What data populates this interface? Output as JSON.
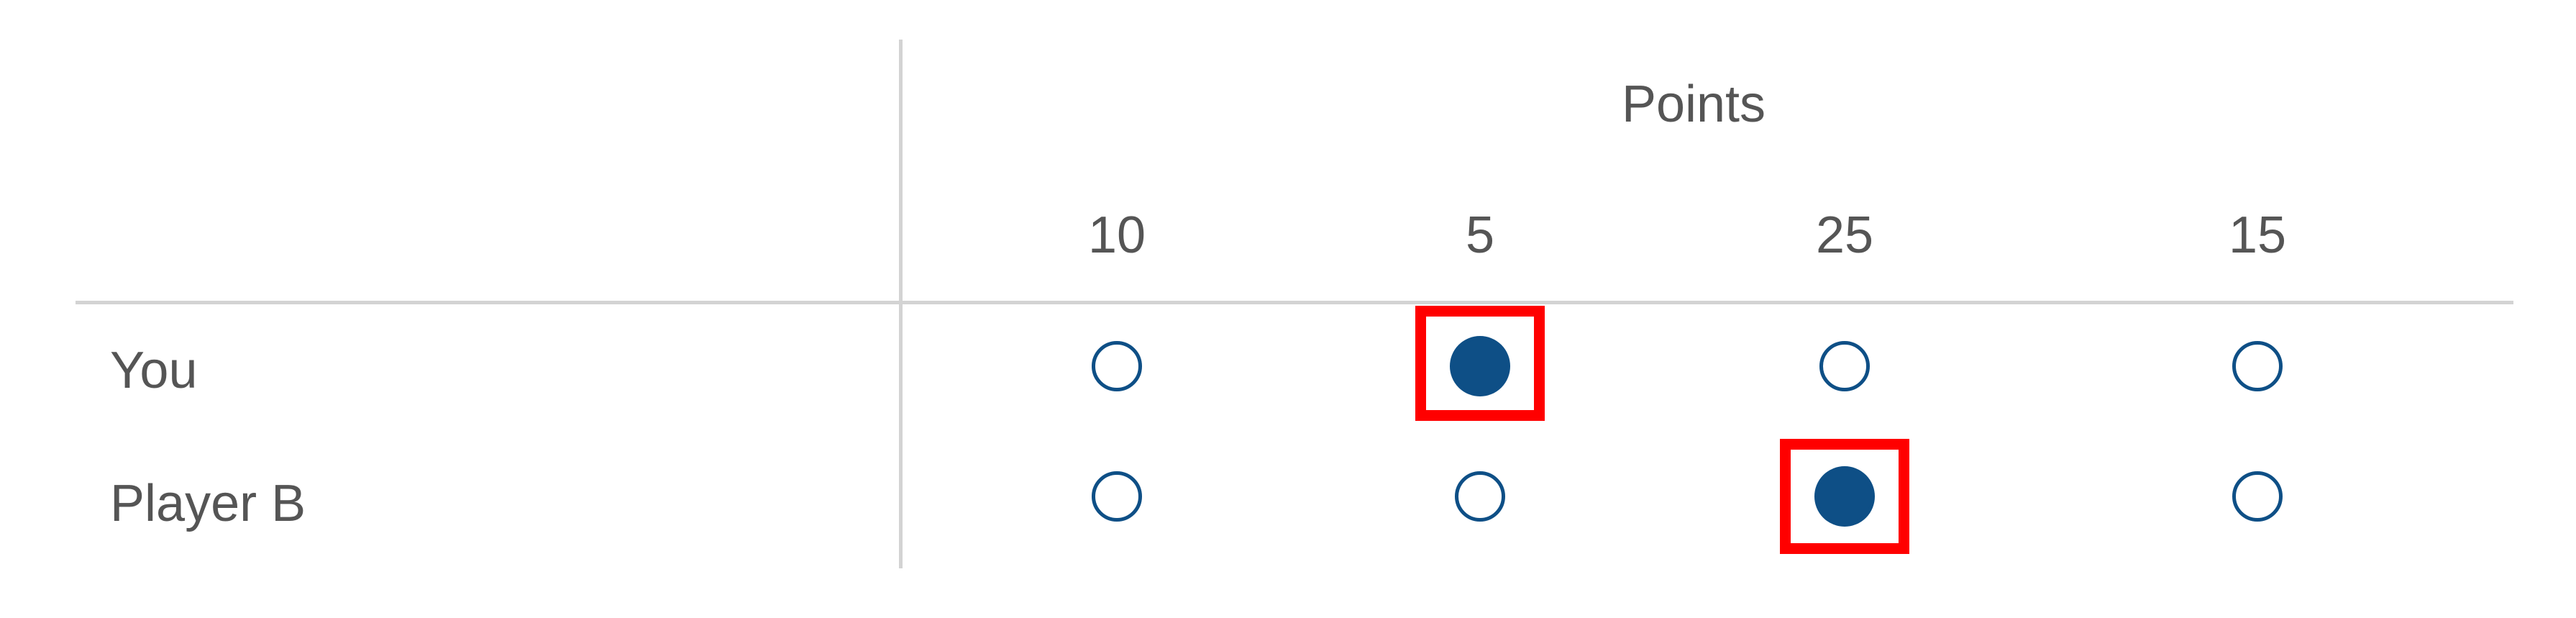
{
  "question": {
    "group_title": "Points",
    "columns": [
      "10",
      "5",
      "25",
      "15"
    ],
    "rows": [
      {
        "label": "You",
        "selected_index": 1
      },
      {
        "label": "Player B",
        "selected_index": 2
      }
    ]
  },
  "colors": {
    "radio": "#0e4f86",
    "highlight": "#ff0000",
    "grid_line": "#d3d3d3",
    "text": "#555555"
  }
}
